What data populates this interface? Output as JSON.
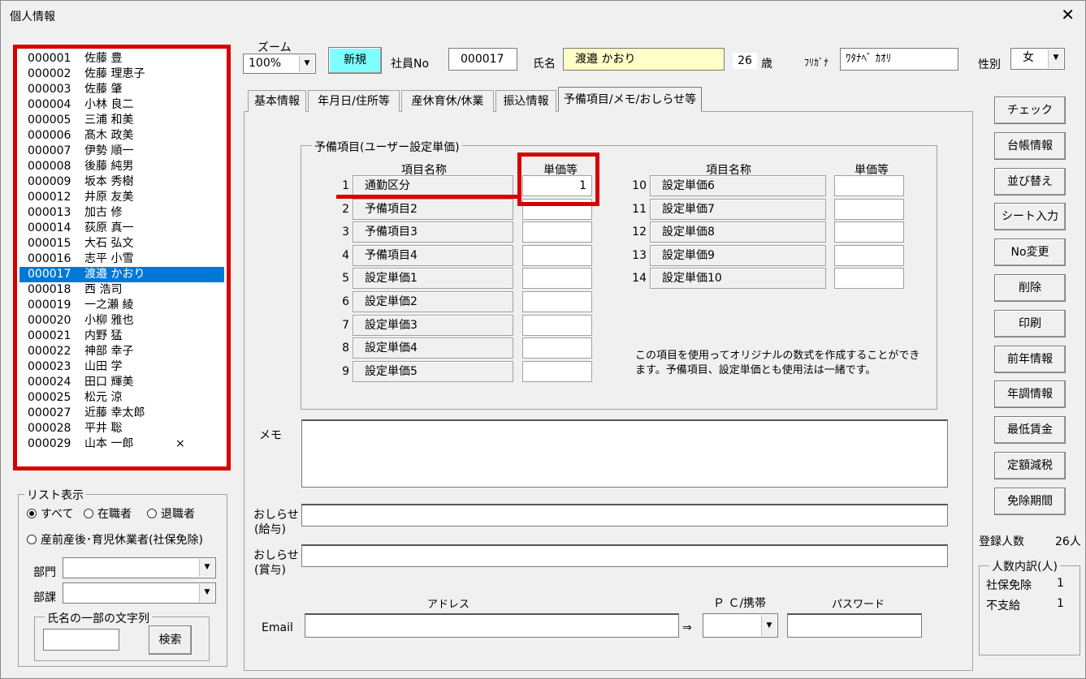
{
  "window": {
    "title": "個人情報",
    "close_glyph": "✕"
  },
  "employees": [
    {
      "no": "000001",
      "name": "佐藤 豊",
      "mark": ""
    },
    {
      "no": "000002",
      "name": "佐藤 理恵子",
      "mark": ""
    },
    {
      "no": "000003",
      "name": "佐藤 肇",
      "mark": ""
    },
    {
      "no": "000004",
      "name": "小林 良二",
      "mark": ""
    },
    {
      "no": "000005",
      "name": "三浦  和美",
      "mark": ""
    },
    {
      "no": "000006",
      "name": "髙木 政美",
      "mark": ""
    },
    {
      "no": "000007",
      "name": "伊勢  順一",
      "mark": ""
    },
    {
      "no": "000008",
      "name": "後藤 純男",
      "mark": ""
    },
    {
      "no": "000009",
      "name": "坂本 秀樹",
      "mark": ""
    },
    {
      "no": "000012",
      "name": "井原 友美",
      "mark": ""
    },
    {
      "no": "000013",
      "name": "加古 修",
      "mark": ""
    },
    {
      "no": "000014",
      "name": "荻原 真一",
      "mark": ""
    },
    {
      "no": "000015",
      "name": "大石 弘文",
      "mark": ""
    },
    {
      "no": "000016",
      "name": "志平 小雪",
      "mark": ""
    },
    {
      "no": "000017",
      "name": "渡邉 かおり",
      "mark": "",
      "selected": true
    },
    {
      "no": "000018",
      "name": "西 浩司",
      "mark": ""
    },
    {
      "no": "000019",
      "name": "一之瀬 綾",
      "mark": ""
    },
    {
      "no": "000020",
      "name": "小柳 雅也",
      "mark": ""
    },
    {
      "no": "000021",
      "name": "内野 猛",
      "mark": ""
    },
    {
      "no": "000022",
      "name": "神部 幸子",
      "mark": ""
    },
    {
      "no": "000023",
      "name": "山田 学",
      "mark": ""
    },
    {
      "no": "000024",
      "name": "田口 輝美",
      "mark": ""
    },
    {
      "no": "000025",
      "name": "松元 涼",
      "mark": ""
    },
    {
      "no": "000027",
      "name": "近藤 幸太郎",
      "mark": ""
    },
    {
      "no": "000028",
      "name": "平井 聡",
      "mark": ""
    },
    {
      "no": "000029",
      "name": "山本 一郎",
      "mark": "×"
    }
  ],
  "list_display": {
    "legend": "リスト表示",
    "opt_all": "すべて",
    "opt_active": "在職者",
    "opt_retired": "退職者",
    "opt_leave": "産前産後･育児休業者(社保免除)",
    "selected": "all",
    "dept_label": "部門",
    "section_label": "部課",
    "search_legend": "氏名の一部の文字列",
    "search_button": "検索"
  },
  "header": {
    "zoom_label": "ズーム",
    "zoom_value": "100%",
    "new_button": "新規",
    "emp_no_label": "社員No",
    "emp_no": "000017",
    "name_label": "氏名",
    "name": "渡邉 かおり",
    "age": "26",
    "age_unit": "歳",
    "furigana_label": "ﾌﾘｶﾞﾅ",
    "furigana": "ﾜﾀﾅﾍﾞ ｶｵﾘ",
    "gender_label": "性別",
    "gender": "女"
  },
  "tabs": [
    "基本情報",
    "年月日/住所等",
    "産休育休/休業",
    "振込情報",
    "予備項目/メモ/おしらせ等"
  ],
  "reserve": {
    "legend": "予備項目(ユーザー設定単価)",
    "col_name": "項目名称",
    "col_price": "単価等",
    "rows_left": [
      {
        "num": "1",
        "name": "通勤区分",
        "value": "1"
      },
      {
        "num": "2",
        "name": "予備項目2",
        "value": ""
      },
      {
        "num": "3",
        "name": "予備項目3",
        "value": ""
      },
      {
        "num": "4",
        "name": "予備項目4",
        "value": ""
      },
      {
        "num": "5",
        "name": "設定単価1",
        "value": ""
      },
      {
        "num": "6",
        "name": "設定単価2",
        "value": ""
      },
      {
        "num": "7",
        "name": "設定単価3",
        "value": ""
      },
      {
        "num": "8",
        "name": "設定単価4",
        "value": ""
      },
      {
        "num": "9",
        "name": "設定単価5",
        "value": ""
      }
    ],
    "rows_right": [
      {
        "num": "10",
        "name": "設定単価6",
        "value": ""
      },
      {
        "num": "11",
        "name": "設定単価7",
        "value": ""
      },
      {
        "num": "12",
        "name": "設定単価8",
        "value": ""
      },
      {
        "num": "13",
        "name": "設定単価9",
        "value": ""
      },
      {
        "num": "14",
        "name": "設定単価10",
        "value": ""
      }
    ],
    "note_line1": "この項目を使用ってオリジナルの数式を作成することができ",
    "note_line2": "ます。予備項目、設定単価とも使用法は一緒です。"
  },
  "memo": {
    "memo_label": "メモ",
    "notice_salary_label1": "おしらせ",
    "notice_salary_label2": "(給与)",
    "notice_bonus_label1": "おしらせ",
    "notice_bonus_label2": "(賞与)",
    "address_label": "アドレス",
    "pc_mobile_label": "Ｐ Ｃ/携帯",
    "password_label": "パスワード",
    "email_label": "Email",
    "arrow": "⇒"
  },
  "side_buttons": [
    "チェック",
    "台帳情報",
    "並び替え",
    "シート入力",
    "No変更",
    "削除",
    "印刷",
    "前年情報",
    "年調情報",
    "最低賃金",
    "定額減税",
    "免除期間"
  ],
  "stats": {
    "registered_label": "登録人数",
    "registered_value": "26人",
    "breakdown_legend": "人数内訳(人)",
    "exempt_label": "社保免除",
    "exempt_value": "1",
    "unpaid_label": "不支給",
    "unpaid_value": "1"
  },
  "colors": {
    "highlight": "#d60000",
    "selection": "#0078d7",
    "new_button": "#7fffff",
    "name_field": "#ffffc8"
  }
}
